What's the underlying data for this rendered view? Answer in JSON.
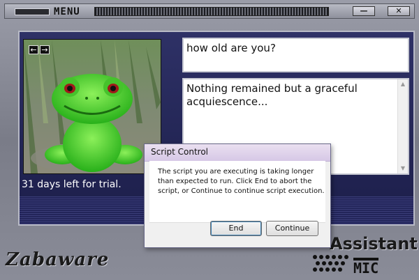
{
  "window": {
    "menu_label": "MENU",
    "minimize_glyph": "—",
    "close_glyph": "✕"
  },
  "photo": {
    "subject": "green frog avatar",
    "prev_glyph": "←",
    "next_glyph": "→"
  },
  "conversation": {
    "user_input": "how old are you?",
    "reply": "Nothing remained but a graceful acquiescence..."
  },
  "status": {
    "trial_text": "31 days left for trial."
  },
  "branding": {
    "logo_text": "Zabaware",
    "product_text": "Assistant",
    "mic_text": "MIC"
  },
  "dialog": {
    "title": "Script Control",
    "message": "The script you are executing is taking longer than expected to run. Click End to abort the script, or Continue to continue script execution.",
    "end_label": "End",
    "continue_label": "Continue"
  },
  "colors": {
    "panel": "#1c1e4a",
    "frame": "#8a8c98",
    "frog": "#3ecf2a"
  }
}
